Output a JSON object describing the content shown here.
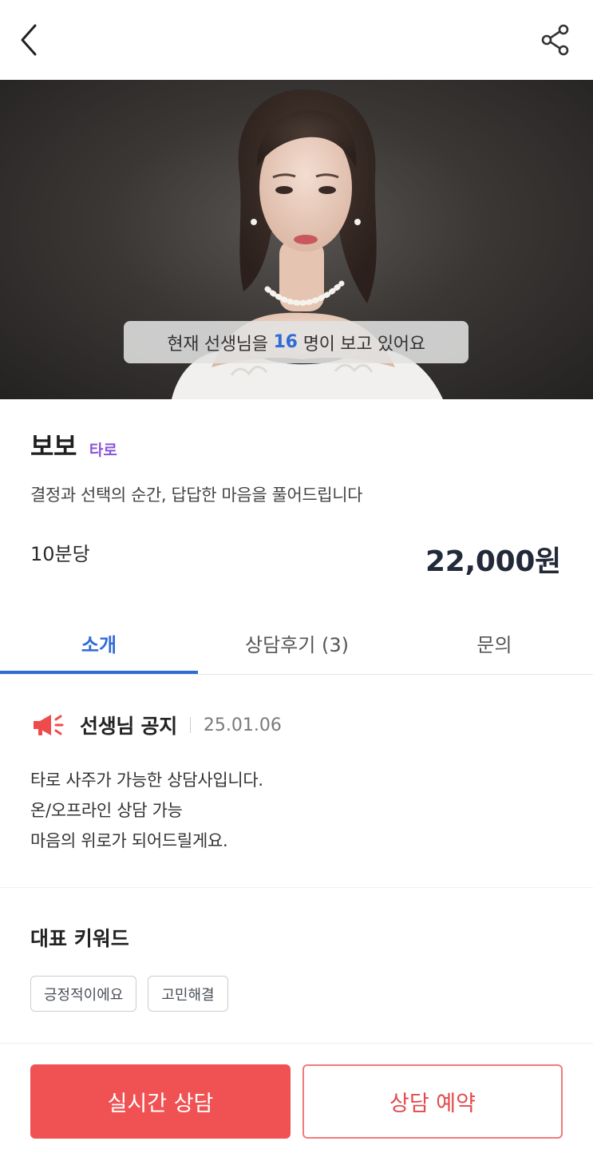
{
  "hero": {
    "viewers_prefix": "현재 선생님을",
    "viewers_count": "16",
    "viewers_suffix": "명이 보고 있어요"
  },
  "profile": {
    "name": "보보",
    "category": "타로",
    "tagline": "결정과 선택의 순간, 답답한 마음을 풀어드립니다",
    "price_unit": "10분당",
    "price": "22,000원"
  },
  "tabs": [
    {
      "label": "소개"
    },
    {
      "label": "상담후기 (3)"
    },
    {
      "label": "문의"
    }
  ],
  "notice": {
    "title": "선생님 공지",
    "date": "25.01.06",
    "lines": [
      "타로 사주가 가능한 상담사입니다.",
      "온/오프라인 상담 가능",
      "마음의 위로가 되어드릴게요."
    ]
  },
  "keywords": {
    "title": "대표 키워드",
    "items": [
      "긍정적이에요",
      "고민해결"
    ]
  },
  "actions": {
    "live": "실시간 상담",
    "reserve": "상담 예약"
  },
  "colors": {
    "accent_blue": "#2f6bd6",
    "category_purple": "#8b56d8",
    "primary_red": "#f05254"
  },
  "icons": {
    "back": "chevron-left-icon",
    "share": "share-icon",
    "notice": "megaphone-icon"
  }
}
